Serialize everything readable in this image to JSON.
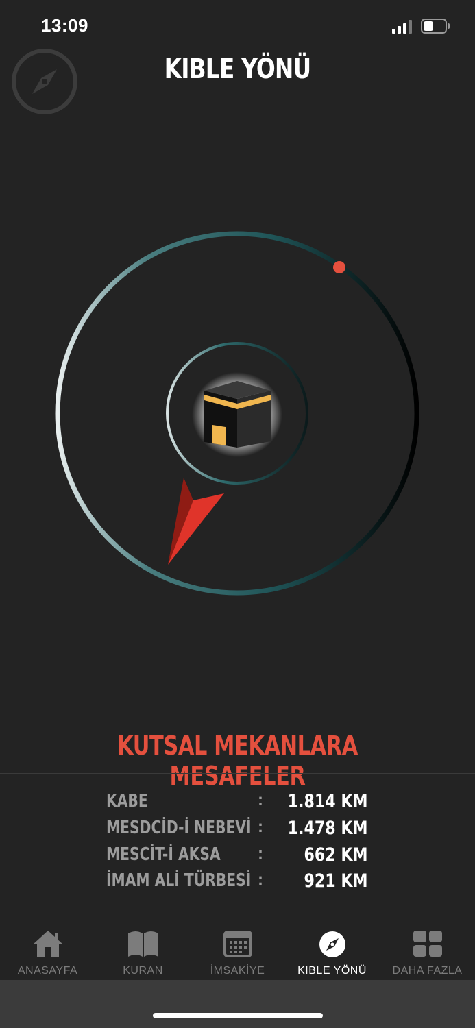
{
  "status_bar": {
    "time": "13:09",
    "battery_level": 0.35
  },
  "header": {
    "title": "KIBLE YÖNÜ",
    "corner_icon": "compass-icon"
  },
  "qibla": {
    "center_icon": "kaaba-icon",
    "pointer_icon": "direction-arrow-icon",
    "marker_color": "#e4503e",
    "ring_color": "#1f5457"
  },
  "distances": {
    "title": "KUTSAL MEKANLARA MESAFELER",
    "title_color": "#e4503e",
    "separator": ":",
    "rows": [
      {
        "name": "KABE",
        "value": "1.814 KM"
      },
      {
        "name": "MESDCİD-İ NEBEVİ",
        "value": "1.478 KM"
      },
      {
        "name": "MESCİT-İ AKSA",
        "value": "662 KM"
      },
      {
        "name": "İMAM ALİ TÜRBESİ",
        "value": "921 KM"
      }
    ]
  },
  "tabbar": {
    "active": "KIBLE YÖNÜ",
    "tabs": [
      {
        "label": "ANASAYFA",
        "icon": "home-icon"
      },
      {
        "label": "KURAN",
        "icon": "book-icon"
      },
      {
        "label": "İMSAKİYE",
        "icon": "calendar-icon"
      },
      {
        "label": "KIBLE YÖNÜ",
        "icon": "compass-icon"
      },
      {
        "label": "DAHA FAZLA",
        "icon": "grid-icon"
      }
    ]
  }
}
